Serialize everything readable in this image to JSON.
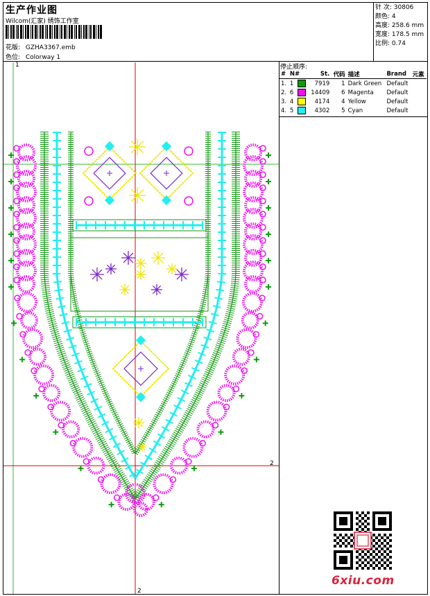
{
  "header": {
    "title": "生产作业图",
    "company": "Wilcom(汇家) 绣饰工作室",
    "design_label": "花版:",
    "design_file": "GZHA3367.emb",
    "colorway_label": "色位:",
    "colorway": "Colorway 1"
  },
  "stats": {
    "stitches_label": "针 次:",
    "stitches": "30806",
    "colors_label": "颜色:",
    "colors": "4",
    "height_label": "高度:",
    "height": "258.6 mm",
    "width_label": "宽度:",
    "width": "178.5 mm",
    "scale_label": "比例:",
    "scale": "0.74"
  },
  "stop_sequence": {
    "title": "停止顺序:",
    "columns": [
      "#",
      "N#",
      "St.",
      "代码",
      "描述",
      "Brand",
      "元素"
    ],
    "rows": [
      {
        "idx": "1.",
        "n": "1",
        "color": "#119a11",
        "st": "7919",
        "code": "1",
        "desc": "Dark Green",
        "brand": "Default"
      },
      {
        "idx": "2.",
        "n": "6",
        "color": "#ee11ee",
        "st": "14409",
        "code": "6",
        "desc": "Magenta",
        "brand": "Default"
      },
      {
        "idx": "3.",
        "n": "4",
        "color": "#ffff00",
        "st": "4174",
        "code": "4",
        "desc": "Yellow",
        "brand": "Default"
      },
      {
        "idx": "4.",
        "n": "5",
        "color": "#22eeee",
        "st": "4302",
        "code": "5",
        "desc": "Cyan",
        "brand": "Default"
      }
    ]
  },
  "markers": {
    "one": "1",
    "two_right": "2",
    "two_bottom": "2"
  },
  "logo": "6xiu.com",
  "colors": {
    "green": "#119a11",
    "magenta": "#ee11ee",
    "yellow": "#f2e600",
    "cyan": "#22eeee",
    "purple": "#7a22cc",
    "guide_red": "#dd0000",
    "guide_green": "#33bb33"
  }
}
